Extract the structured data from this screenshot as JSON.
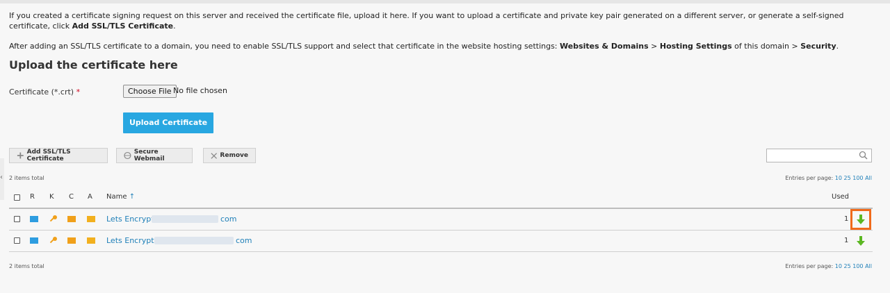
{
  "intro": {
    "p1_text": "If you created a certificate signing request on this server and received the certificate file, upload it here. If you want to upload a certificate and private key pair generated on a different server, or generate a self-signed certificate, click ",
    "p1_bold": "Add SSL/TLS Certificate",
    "p1_end": ".",
    "p2_text": "After adding an SSL/TLS certificate to a domain, you need to enable SSL/TLS support and select that certificate in the website hosting settings: ",
    "p2_bold1": "Websites & Domains",
    "p2_sep1": " > ",
    "p2_bold2": "Hosting Settings",
    "p2_mid": " of this domain > ",
    "p2_bold3": "Security",
    "p2_end": "."
  },
  "upload": {
    "heading": "Upload the certificate here",
    "cert_label": "Certificate (*.crt) ",
    "required_mark": "*",
    "choose_file": "Choose File",
    "no_file": "No file chosen",
    "upload_button": "Upload Certificate"
  },
  "toolbar": {
    "add": "Add SSL/TLS Certificate",
    "secure_webmail": "Secure Webmail",
    "remove": "Remove",
    "search_placeholder": ""
  },
  "list": {
    "total": "2 items total",
    "entries_label": "Entries per page:",
    "per_page": [
      "10",
      "25",
      "100",
      "All"
    ],
    "columns": {
      "r": "R",
      "k": "K",
      "c": "C",
      "a": "A",
      "name": "Name",
      "sort_arrow": "↑",
      "used": "Used"
    },
    "rows": [
      {
        "name_prefix": "Lets Encrypt",
        "name_suffix": "com",
        "used": "1"
      },
      {
        "name_prefix": "Lets Encrypt t",
        "name_suffix": "com",
        "used": "1"
      }
    ]
  },
  "colors": {
    "accent": "#28a7e1",
    "link": "#1e7fb8",
    "highlight": "#f06a1b",
    "download": "#5bb722"
  }
}
